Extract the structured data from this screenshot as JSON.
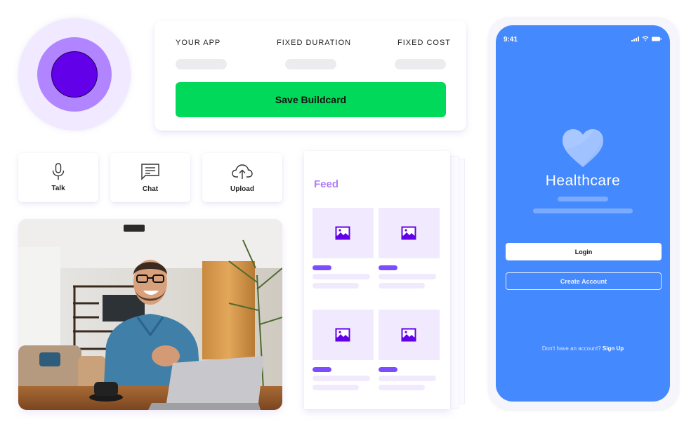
{
  "avatar": {
    "colors": {
      "outer": "#f1e9ff",
      "middle": "#b085ff",
      "inner": "#6200ea"
    }
  },
  "buildcard": {
    "columns": [
      {
        "label": "YOUR APP"
      },
      {
        "label": "FIXED DURATION"
      },
      {
        "label": "FIXED COST"
      }
    ],
    "save_label": "Save Buildcard",
    "accent": "#00d95a"
  },
  "actions": [
    {
      "label": "Talk",
      "icon": "microphone-icon"
    },
    {
      "label": "Chat",
      "icon": "chat-bubble-icon"
    },
    {
      "label": "Upload",
      "icon": "cloud-upload-icon"
    }
  ],
  "photo": {
    "description": "Smiling man with glasses in denim shirt sitting at a wooden table with a laptop and coffee cup"
  },
  "feed": {
    "title": "Feed",
    "accent": "#b07cf7",
    "items": [
      {
        "icon": "image-placeholder-icon"
      },
      {
        "icon": "image-placeholder-icon"
      },
      {
        "icon": "image-placeholder-icon"
      },
      {
        "icon": "image-placeholder-icon"
      }
    ]
  },
  "phone": {
    "status_time": "9:41",
    "status_icons": [
      "signal-icon",
      "wifi-icon",
      "battery-icon"
    ],
    "app_title": "Healthcare",
    "login_label": "Login",
    "create_account_label": "Create Account",
    "signup_prompt": "Don't have an account?",
    "signup_link": "Sign Up",
    "screen_color": "#4489fe"
  }
}
